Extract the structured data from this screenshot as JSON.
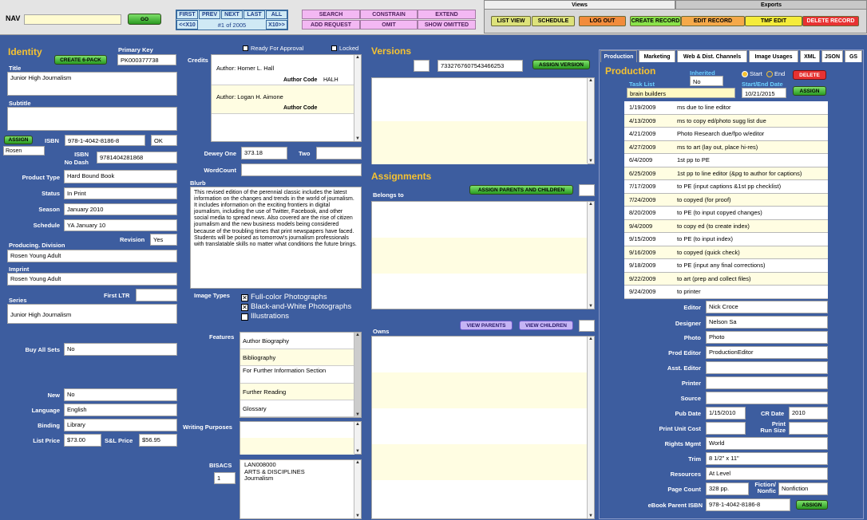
{
  "nav": {
    "label": "NAV",
    "go": "GO",
    "first": "FIRST",
    "prev": "PREV",
    "next": "NEXT",
    "last": "LAST",
    "all": "ALL",
    "back10": "<<X10",
    "record_pos": "#1 of 2005",
    "fwd10": "X10>>"
  },
  "actions": {
    "search": "SEARCH",
    "constrain": "CONSTRAIN",
    "extend": "EXTEND",
    "add_request": "ADD REQUEST",
    "omit": "OMIT",
    "show_omitted": "SHOW OMITTED"
  },
  "views": {
    "tab_views": "Views",
    "tab_exports": "Exports",
    "list_view": "LIST VIEW",
    "schedule": "SCHEDULE",
    "log_out": "LOG OUT",
    "create_record": "CREATE RECORD",
    "edit_record": "EDIT RECORD",
    "tmf_edit": "TMF EDIT",
    "delete_record": "DELETE RECORD"
  },
  "identity": {
    "heading": "Identity",
    "primary_key_label": "Primary Key",
    "create6": "CREATE 6-PACK",
    "primary_key": "PK000377738",
    "title_label": "Title",
    "title": "Junior High Journalism",
    "subtitle_label": "Subtitle",
    "subtitle": "",
    "assign": "ASSIGN",
    "isbn_label": "ISBN",
    "isbn": "978-1-4042-8186-8",
    "isbn_status": "OK",
    "publisher": "Rosen",
    "isbn_nodash_label1": "ISBN",
    "isbn_nodash_label2": "No Dash",
    "isbn_nodash": "9781404281868",
    "product_type_label": "Product Type",
    "product_type": "Hard Bound Book",
    "status_label": "Status",
    "status": "In Print",
    "season_label": "Season",
    "season": "January 2010",
    "schedule_label": "Schedule",
    "schedule": "YA January 10",
    "revision_label": "Revision",
    "revision": "Yes",
    "division_label": "Producing. Division",
    "division": "Rosen Young Adult",
    "imprint_label": "Imprint",
    "imprint": "Rosen Young Adult",
    "first_ltr_label": "First LTR",
    "first_ltr": "",
    "series_label": "Series",
    "series": "Junior High Journalism",
    "buy_all_label": "Buy All Sets",
    "buy_all": "No",
    "new_label": "New",
    "new": "No",
    "language_label": "Language",
    "language": "English",
    "binding_label": "Binding",
    "binding": "Library",
    "list_price_label": "List Price",
    "list_price": "$73.00",
    "sl_price_label": "S&L Price",
    "sl_price": "$56.95"
  },
  "credits": {
    "ready_label": "Ready For Approval",
    "locked_label": "Locked",
    "credits_label": "Credits",
    "author1": "Author: Homer L. Hall",
    "code_label": "Author Code",
    "code1": "HALH",
    "author2": "Author: Logan H. Aimone",
    "code2": "",
    "dewey_label": "Dewey One",
    "dewey": "373.18",
    "two_label": "Two",
    "two": "",
    "wordcount_label": "WordCount",
    "wordcount": "",
    "blurb_label": "Blurb",
    "blurb": "This revised edition of the perennial classic includes the latest information on the changes and trends in the world of journalism. It includes information on the exciting frontiers in digital journalism, including the use of Twitter, Facebook, and other social media to spread news. Also covered are the rise of citizen journalism and the new business models being considered because of the troubling times that print newspapers have faced. Students will be poised as tomorrow's journalism professionals with translatable skills no matter what conditions the future brings.",
    "image_types_label": "Image Types",
    "img1": "Full-color Photographs",
    "img2": "Black-and-White Photographs",
    "img3": "Illustrations",
    "features_label": "Features",
    "feat1": "Author Biography",
    "feat2": "Bibliography",
    "feat3": "For Further Information Section",
    "feat4": "Further Reading",
    "feat5": "Glossary",
    "writing_label": "Writing Purposes",
    "bisacs_label": "BISACS",
    "bisacs_count": "1",
    "bisacs": "LAN008000\nARTS & DISCIPLINES\nJournalism"
  },
  "versions": {
    "heading": "Versions",
    "version_id": "7332767607543466253",
    "assign_version": "ASSIGN VERSION",
    "assign_heading": "Assignments",
    "belongs_label": "Belongs to",
    "assign_parents": "ASSIGN PARENTS AND CHILDREN",
    "owns_label": "Owns",
    "view_parents": "VIEW PARENTS",
    "view_children": "VIEW CHILDREN"
  },
  "tabs": [
    "Production",
    "Marketing",
    "Web & Dist. Channels",
    "Image Usages",
    "XML",
    "JSON",
    "GS"
  ],
  "production": {
    "heading": "Production",
    "inherited_label": "Inherited",
    "inherited": "No",
    "start_label": "Start",
    "end_label": "End",
    "delete": "DELETE",
    "task_list_label": "Task List",
    "task_list": "brain builders",
    "date_label": "Start/End Date",
    "date": "10/21/2015",
    "assign": "ASSIGN",
    "tasks": [
      {
        "date": "1/19/2009",
        "task": "ms due to line editor"
      },
      {
        "date": "4/13/2009",
        "task": "ms to copy ed/photo sugg list due"
      },
      {
        "date": "4/21/2009",
        "task": "Photo Research due/fpo w/editor"
      },
      {
        "date": "4/27/2009",
        "task": "ms to art (lay out, place hi-res)"
      },
      {
        "date": "6/4/2009",
        "task": "1st pp to PE"
      },
      {
        "date": "6/25/2009",
        "task": "1st pp to line editor (&pg to author for captions)"
      },
      {
        "date": "7/17/2009",
        "task": "to PE (input captions &1st pp checklist)"
      },
      {
        "date": "7/24/2009",
        "task": "to copyed (for proof)"
      },
      {
        "date": "8/20/2009",
        "task": "to PE (to input copyed changes)"
      },
      {
        "date": "9/4/2009",
        "task": "to copy ed (to create index)"
      },
      {
        "date": "9/15/2009",
        "task": "to PE (to input index)"
      },
      {
        "date": "9/16/2009",
        "task": "to copyed (quick check)"
      },
      {
        "date": "9/18/2009",
        "task": "to PE (input any final corrections)"
      },
      {
        "date": "9/22/2009",
        "task": "to art (prep and collect files)"
      },
      {
        "date": "9/24/2009",
        "task": "to printer"
      }
    ],
    "editor_label": "Editor",
    "editor": "Nick Croce",
    "designer_label": "Designer",
    "designer": "Nelson Sa",
    "photo_label": "Photo",
    "photo": "Photo",
    "prod_editor_label": "Prod Editor",
    "prod_editor": "ProductionEditor",
    "asst_editor_label": "Asst. Editor",
    "asst_editor": "",
    "printer_label": "Printer",
    "printer": "",
    "source_label": "Source",
    "source": "",
    "pub_date_label": "Pub Date",
    "pub_date": "1/15/2010",
    "cr_date_label": "CR Date",
    "cr_date": "2010",
    "unit_cost_label": "Print Unit Cost",
    "unit_cost": "",
    "run_size_label1": "Print",
    "run_size_label2": "Run Size",
    "run_size": "",
    "rights_label": "Rights Mgmt",
    "rights": "World",
    "trim_label": "Trim",
    "trim": "8 1/2\" x 11\"",
    "resources_label": "Resources",
    "resources": "At Level",
    "page_count_label": "Page Count",
    "page_count": "328 pp.",
    "fiction_label1": "Fiction/",
    "fiction_label2": "Nonfic",
    "fiction": "Nonfiction",
    "ebook_label": "eBook Parent ISBN",
    "ebook": "978-1-4042-8186-8",
    "ebook_assign": "ASSIGN"
  }
}
